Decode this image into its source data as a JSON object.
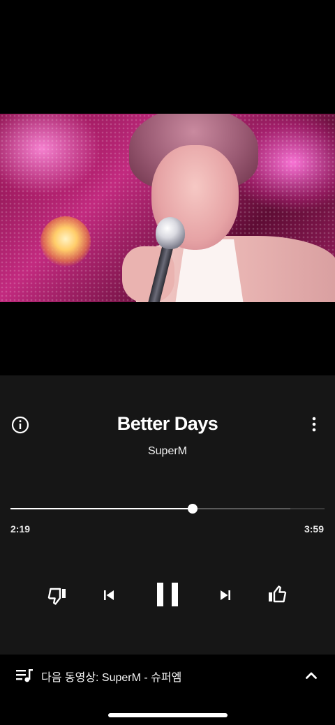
{
  "player": {
    "song_title": "Better Days",
    "artist": "SuperM",
    "elapsed": "2:19",
    "total": "3:59",
    "progress_fraction": 0.581,
    "buffered_fraction": 0.89,
    "is_playing": true
  },
  "icons": {
    "info": "info-circle-icon",
    "more": "more-vertical-icon",
    "dislike": "thumbs-down-icon",
    "previous": "skip-previous-icon",
    "pause": "pause-icon",
    "next": "skip-next-icon",
    "like": "thumbs-up-icon",
    "queue": "queue-music-icon",
    "expand": "chevron-up-icon"
  },
  "up_next": {
    "text": "다음 동영상: SuperM - 슈퍼엠"
  },
  "colors": {
    "panel_background": "#161616",
    "accent": "#ffffff",
    "track": "#3a3a3a"
  }
}
